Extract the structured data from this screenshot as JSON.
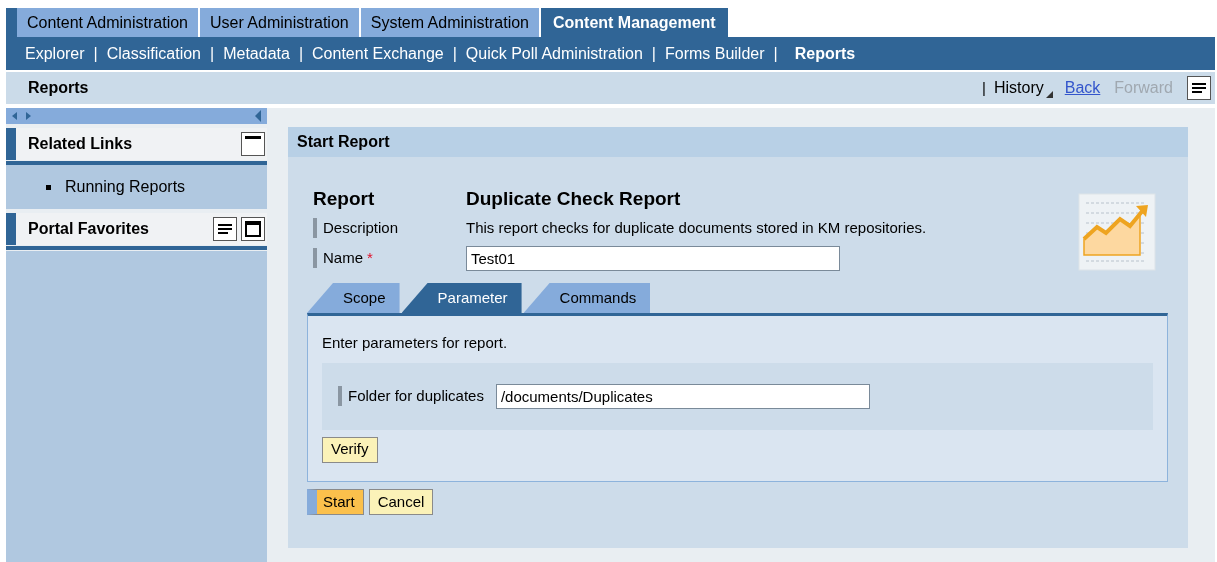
{
  "top_tabs": [
    {
      "label": "Content Administration",
      "selected": false
    },
    {
      "label": "User Administration",
      "selected": false
    },
    {
      "label": "System Administration",
      "selected": false
    },
    {
      "label": "Content Management",
      "selected": true
    }
  ],
  "sub_nav": {
    "separator": "|",
    "items": [
      {
        "label": "Explorer",
        "selected": false
      },
      {
        "label": "Classification",
        "selected": false
      },
      {
        "label": "Metadata",
        "selected": false
      },
      {
        "label": "Content Exchange",
        "selected": false
      },
      {
        "label": "Quick Poll Administration",
        "selected": false
      },
      {
        "label": "Forms Builder",
        "selected": false
      },
      {
        "label": "Reports",
        "selected": true
      }
    ]
  },
  "page_title": "Reports",
  "history_bar": {
    "separator": "|",
    "history": "History",
    "back": "Back",
    "forward": "Forward",
    "forward_disabled": true
  },
  "sidebar": {
    "panels": [
      {
        "title": "Related Links",
        "expanded": true,
        "links": [
          "Running Reports"
        ]
      },
      {
        "title": "Portal Favorites",
        "expanded": false
      }
    ]
  },
  "form": {
    "title": "Start Report",
    "report_label": "Report",
    "report_name": "Duplicate Check Report",
    "required_mark": "*",
    "fields": [
      {
        "kind": "text",
        "label": "Description",
        "required": false,
        "value": "This report checks for duplicate documents stored in KM repositories."
      },
      {
        "kind": "input",
        "label": "Name",
        "required": true,
        "value": "Test01"
      }
    ],
    "tabs": [
      {
        "label": "Scope",
        "selected": false
      },
      {
        "label": "Parameter",
        "selected": true
      },
      {
        "label": "Commands",
        "selected": false
      }
    ],
    "tab_panel": {
      "intro": "Enter parameters for report.",
      "fields": [
        {
          "label": "Folder for duplicates",
          "value": "/documents/Duplicates"
        }
      ],
      "buttons": [
        "Verify"
      ]
    },
    "buttons": [
      {
        "label": "Start",
        "primary": true
      },
      {
        "label": "Cancel",
        "primary": false
      }
    ]
  }
}
